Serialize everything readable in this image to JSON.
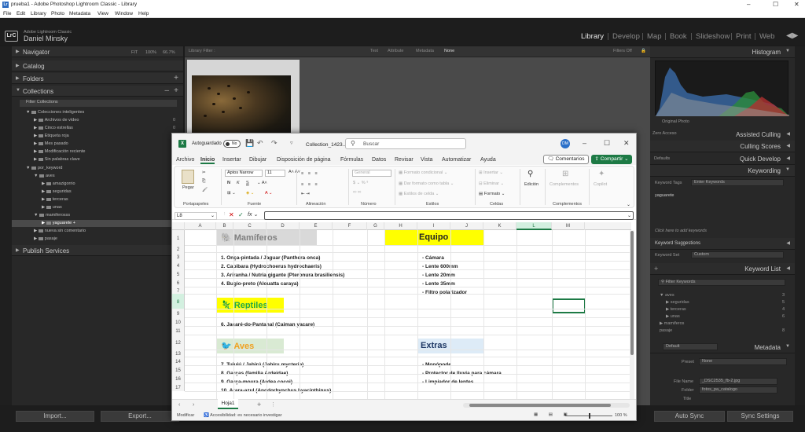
{
  "window": {
    "title": "prueba1 - Adobe Photoshop Lightroom Classic - Library",
    "menu": [
      "File",
      "Edit",
      "Library",
      "Photo",
      "Metadata",
      "View",
      "Window",
      "Help"
    ]
  },
  "identity": {
    "product": "Adobe Lightroom Classic",
    "user": "Daniel Minsky",
    "modules": [
      "Library",
      "Develop",
      "Map",
      "Book",
      "Slideshow",
      "Print",
      "Web"
    ],
    "active": "Library"
  },
  "left": {
    "navigator": "Navigator",
    "nav_zoom": [
      "FIT",
      "100%",
      "66.7%"
    ],
    "catalog": "Catalog",
    "folders": "Folders",
    "collections": "Collections",
    "filter": "Filter Collections",
    "smart": "Colecciones inteligentes",
    "smart_items": [
      {
        "label": "Archivos de vídeo",
        "count": "0"
      },
      {
        "label": "Cinco estrellas",
        "count": "0"
      },
      {
        "label": "Etiqueta roja",
        "count": "0"
      },
      {
        "label": "Mes pasado",
        "count": "0"
      },
      {
        "label": "Modificación reciente",
        "count": "0"
      },
      {
        "label": "Sin palabras clave",
        "count": "0"
      }
    ],
    "por_keyword": "por_keyword",
    "aves": "aves",
    "aves_items": [
      "amazigorrio",
      "seguridas",
      "terceras",
      "unas"
    ],
    "mamiferosss": "mamiferosss",
    "yaguarete": "yaguarete",
    "nueva": "nueva sin comentario",
    "pasaje": "pasaje",
    "publish": "Publish Services"
  },
  "filterbar": {
    "title": "Library Filter :",
    "options": [
      "Text",
      "Attribute",
      "Metadata",
      "None"
    ],
    "filters_off": "Filters Off"
  },
  "right": {
    "histogram": "Histogram",
    "original": "Original Photo",
    "zero_acc": "Zero Acceso",
    "assisted": "Assisted Culling",
    "scores": "Culling Scores",
    "quick": "Quick Develop",
    "defaults": "Defaults",
    "keywording": "Keywording",
    "kw_tags": "Keyword Tags",
    "enter_kw": "Enter Keywords",
    "kw_value": "yaguarete",
    "click_add": "Click here to add keywords",
    "suggestions": "Keyword Suggestions",
    "kw_set": "Keyword Set",
    "custom": "Custom",
    "kw_list": "Keyword List",
    "filter_kw": "Filter Keywords",
    "kw_items": [
      {
        "label": "aves",
        "count": "3"
      },
      {
        "label": "seguridas",
        "count": "5"
      },
      {
        "label": "terceras",
        "count": "4"
      },
      {
        "label": "unas",
        "count": "6"
      },
      {
        "label": "mamiferos",
        "count": ""
      },
      {
        "label": "pasaje",
        "count": "8"
      }
    ],
    "default": "Default",
    "metadata": "Metadata",
    "preset": "Preset",
    "none": "None",
    "filename_lbl": "File Name",
    "filename": "_DSC2535_fb-2.jpg",
    "folder_lbl": "Folder",
    "folder": "fotos_pa_catalogo",
    "title_lbl": "Title"
  },
  "bottom": {
    "import": "Import...",
    "export": "Export...",
    "sync": "Auto Sync",
    "sync_settings": "Sync Settings"
  },
  "excel": {
    "autosave": "Autoguardado",
    "off": "No",
    "file": "Collection_1423...",
    "search": "Buscar",
    "initials": "DM",
    "tabs": [
      "Archivo",
      "Inicio",
      "Insertar",
      "Dibujar",
      "Disposición de página",
      "Fórmulas",
      "Datos",
      "Revisar",
      "Vista",
      "Automatizar",
      "Ayuda"
    ],
    "active_tab": "Inicio",
    "comentarios": "Comentarios",
    "compartir": "Compartir",
    "ribbon": {
      "pegar": "Pegar",
      "portapapeles": "Portapapeles",
      "font": "Aptos Narrow",
      "size": "11",
      "fuente": "Fuente",
      "alineacion": "Alineación",
      "general": "General",
      "numero": "Número",
      "formato_cond": "Formato condicional",
      "dar_formato": "Dar formato como tabla",
      "estilos_celda": "Estilos de celda",
      "estilos": "Estilos",
      "insertar": "Insertar",
      "eliminar": "Eliminar",
      "formato": "Formato",
      "celdas": "Celdas",
      "edicion": "Edición",
      "complementos": "Complementos",
      "copilot": "Copilot"
    },
    "cell_ref": "L8",
    "columns": [
      "A",
      "B",
      "C",
      "D",
      "E",
      "F",
      "G",
      "H",
      "I",
      "J",
      "K",
      "L",
      "M"
    ],
    "rows": [
      "1",
      "2",
      "3",
      "4",
      "5",
      "6",
      "7",
      "8",
      "9",
      "10",
      "11",
      "12",
      "13",
      "14",
      "15",
      "16",
      "17"
    ],
    "mamiferos": {
      "title": "Mamíferos",
      "items": [
        "1. Onça-pintada / Jaguar (Panthera onca)",
        "2. Capibara (Hydrochoerus hydrochaeris)",
        "3. Ariranha / Nutria gigante (Pteronura brasiliensis)",
        "4. Bugio-preto (Alouatta caraya)"
      ]
    },
    "reptiles": {
      "title": "Reptiles",
      "items": [
        "6. Jacaré-do-Pantanal (Caiman yacare)"
      ]
    },
    "aves": {
      "title": "Aves",
      "items": [
        "7. Tuiuiú / Jabirú (Jabiru mycteria)",
        "8. Garças (familia Ardeidae)",
        "9. Garça-moura (Ardea cocoi)",
        "10. Arara-azul (Anodorhynchus hyacinthinus)"
      ]
    },
    "equipo": {
      "title": "Equipo",
      "items": [
        "- Cámara",
        "- Lente 600mm",
        "- Lente 20mm",
        "- Lente 35mm",
        "- Filtro polarizador"
      ]
    },
    "extras": {
      "title": "Extras",
      "items": [
        "- Monópode",
        "- Protector de lluvia para cámara",
        "- Limpiador de lentes"
      ]
    },
    "sheet": "Hoja1",
    "status_mod": "Modificar",
    "status_acc": "Accesibilidad: es necesario investigar",
    "zoom": "100 %",
    "colors": {
      "mamiferos": "#d9d9d9",
      "reptiles": "#ffff00",
      "aves": "#d9ead3",
      "equipo": "#ffff00",
      "extras": "#ddebf7",
      "green": "#1d7a45"
    }
  }
}
